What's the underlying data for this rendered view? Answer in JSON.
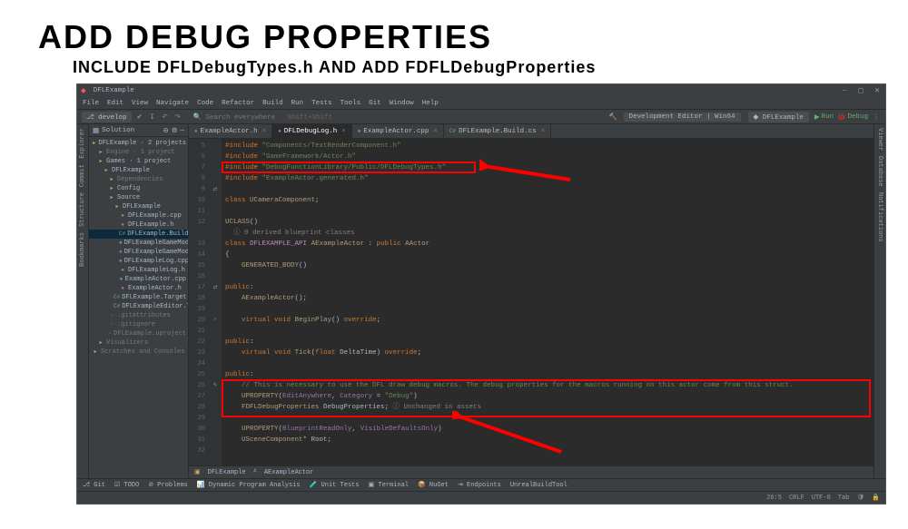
{
  "slide": {
    "title": "ADD DEBUG PROPERTIES",
    "subtitle": "INCLUDE DFLDebugTypes.h AND ADD FDFLDebugProperties"
  },
  "app": {
    "name": "DFLExample"
  },
  "menu": [
    "File",
    "Edit",
    "View",
    "Navigate",
    "Code",
    "Refactor",
    "Build",
    "Run",
    "Tests",
    "Tools",
    "Git",
    "Window",
    "Help"
  ],
  "toolbar": {
    "branch": "develop",
    "search_hint": "Search everywhere",
    "shortcut_hint": "Shift+Shift",
    "config": "Development Editor | Win64",
    "target": "DFLExample",
    "run": "Run",
    "debug": "Debug"
  },
  "sidebar": {
    "title": "Solution"
  },
  "tree": [
    {
      "d": 0,
      "t": "DFLExample · 2 projects",
      "ico": "folder"
    },
    {
      "d": 1,
      "t": "Engine · 1 project",
      "ico": "folder",
      "muted": true
    },
    {
      "d": 1,
      "t": "Games · 1 project",
      "ico": "folder"
    },
    {
      "d": 2,
      "t": "DFLExample",
      "ico": "folder"
    },
    {
      "d": 3,
      "t": "Dependencies",
      "ico": "folder",
      "muted": true
    },
    {
      "d": 3,
      "t": "Config",
      "ico": "folder"
    },
    {
      "d": 3,
      "t": "Source",
      "ico": "folder"
    },
    {
      "d": 4,
      "t": "DFLExample",
      "ico": "folder"
    },
    {
      "d": 5,
      "t": "DFLExample.cpp",
      "ico": "cpp"
    },
    {
      "d": 5,
      "t": "DFLExample.h",
      "ico": "h"
    },
    {
      "d": 5,
      "t": "DFLExample.Build.cs",
      "ico": "cs",
      "sel": true
    },
    {
      "d": 5,
      "t": "DFLExampleGameModeBase.cpp",
      "ico": "cpp"
    },
    {
      "d": 5,
      "t": "DFLExampleGameModeBase.h",
      "ico": "h"
    },
    {
      "d": 5,
      "t": "DFLExampleLog.cpp",
      "ico": "cpp"
    },
    {
      "d": 5,
      "t": "DFLExampleLog.h",
      "ico": "h"
    },
    {
      "d": 5,
      "t": "ExampleActor.cpp",
      "ico": "cpp"
    },
    {
      "d": 5,
      "t": "ExampleActor.h",
      "ico": "h"
    },
    {
      "d": 4,
      "t": "DFLExample.Target.cs",
      "ico": "cs"
    },
    {
      "d": 4,
      "t": "DFLExampleEditor.Target.cs",
      "ico": "cs"
    },
    {
      "d": 3,
      "t": ".gitattributes",
      "ico": "file",
      "muted": true
    },
    {
      "d": 3,
      "t": ".gitignore",
      "ico": "file",
      "muted": true
    },
    {
      "d": 3,
      "t": "DFLExample.uproject",
      "ico": "file",
      "muted": true
    },
    {
      "d": 1,
      "t": "Visualizers",
      "ico": "folder",
      "muted": true
    },
    {
      "d": 0,
      "t": "Scratches and Consoles",
      "ico": "folder",
      "muted": true
    }
  ],
  "tabs": [
    {
      "label": "ExampleActor.h",
      "ico": "h"
    },
    {
      "label": "DFLDebugLog.h",
      "ico": "h",
      "active": true
    },
    {
      "label": "ExampleActor.cpp",
      "ico": "cpp"
    },
    {
      "label": "DFLExample.Build.cs",
      "ico": "cs"
    }
  ],
  "code": {
    "first_line_no": 5,
    "lines": [
      {
        "n": 5,
        "html": "<span class='orange'>#include</span> <span class='str'>\"Components/TextRenderComponent.h\"</span>"
      },
      {
        "n": 6,
        "html": "<span class='orange'>#include</span> <span class='str'>\"GameFramework/Actor.h\"</span>"
      },
      {
        "n": 7,
        "html": "<span class='orange'>#include</span> <span class='str'>\"DebugFunctionLibrary/Public/DFLDebugTypes.h\"</span>"
      },
      {
        "n": 8,
        "html": "<span class='orange'>#include</span> <span class='str'>\"ExampleActor.generated.h\"</span>"
      },
      {
        "n": 9,
        "html": "",
        "glyph": "⇄"
      },
      {
        "n": 10,
        "html": "<span class='kw'>class</span> <span class='ucls'>UCameraComponent</span>;"
      },
      {
        "n": 11,
        "html": ""
      },
      {
        "n": 12,
        "html": "<span class='propmacro'>UCLASS</span>()"
      },
      {
        "n": "",
        "html": "<span class='cmt'>  ⓘ 0 derived blueprint classes</span>"
      },
      {
        "n": 13,
        "html": "<span class='kw'>class</span> <span class='purple'>DFLEXAMPLE_API</span> <span class='ucls'>AExampleActor</span> : <span class='kw'>public</span> <span class='ucls'>AActor</span>"
      },
      {
        "n": 14,
        "html": "{"
      },
      {
        "n": 15,
        "html": "    <span class='propmacro'>GENERATED_BODY</span>()"
      },
      {
        "n": 16,
        "html": ""
      },
      {
        "n": 17,
        "html": "<span class='kw'>public</span>:",
        "glyph": "⇄"
      },
      {
        "n": 18,
        "html": "    <span class='ucls'>AExampleActor</span>();"
      },
      {
        "n": 19,
        "html": ""
      },
      {
        "n": 20,
        "html": "    <span class='kw'>virtual</span> <span class='kw'>void</span> <span class='propmacro'>BeginPlay</span>() <span class='kw'>override</span>;",
        "glyph": "ᵒ"
      },
      {
        "n": 21,
        "html": ""
      },
      {
        "n": 22,
        "html": "<span class='kw'>public</span>:"
      },
      {
        "n": 23,
        "html": "    <span class='kw'>virtual</span> <span class='kw'>void</span> <span class='propmacro'>Tick</span>(<span class='kw'>float</span> DeltaTime) <span class='kw'>override</span>;"
      },
      {
        "n": 24,
        "html": ""
      },
      {
        "n": 25,
        "html": "<span class='kw'>public</span>:"
      },
      {
        "n": 26,
        "html": "    <span class='greentxt'>// This is necessary to use the DFL draw debug macros. The debug properties for the macros running on this actor come from this struct.</span>",
        "glyph": "✎"
      },
      {
        "n": 27,
        "html": "    <span class='propmacro'>UPROPERTY</span>(<span class='magenta'>EditAnywhere</span>, <span class='magenta'>Category</span> = <span class='str'>\"Debug\"</span>)"
      },
      {
        "n": 28,
        "html": "    <span class='ucls'>FDFLDebugProperties</span> DebugProperties; <span class='cmt'>ⓘ Unchanged in assets</span>"
      },
      {
        "n": 29,
        "html": ""
      },
      {
        "n": 30,
        "html": "    <span class='propmacro'>UPROPERTY</span>(<span class='magenta'>BlueprintReadOnly</span>, <span class='magenta'>VisibleDefaultsOnly</span>)"
      },
      {
        "n": 31,
        "html": "    <span class='ucls'>USceneComponent</span>* Root;"
      },
      {
        "n": 32,
        "html": ""
      }
    ]
  },
  "crumbs": [
    "DFLExample",
    "AExampleActor"
  ],
  "left_tabs": [
    "Explorer",
    "Commit",
    "Structure",
    "Bookmarks"
  ],
  "right_tabs": [
    "Viewer",
    "Database",
    "Notifications"
  ],
  "bottom_tools": [
    "Git",
    "TODO",
    "Problems",
    "Dynamic Program Analysis",
    "Unit Tests",
    "Terminal",
    "NuGet",
    "Endpoints",
    "UnrealBuildTool"
  ],
  "status": {
    "pos": "26:5",
    "eol": "CRLF",
    "enc": "UTF-8",
    "tab": "Tab"
  }
}
